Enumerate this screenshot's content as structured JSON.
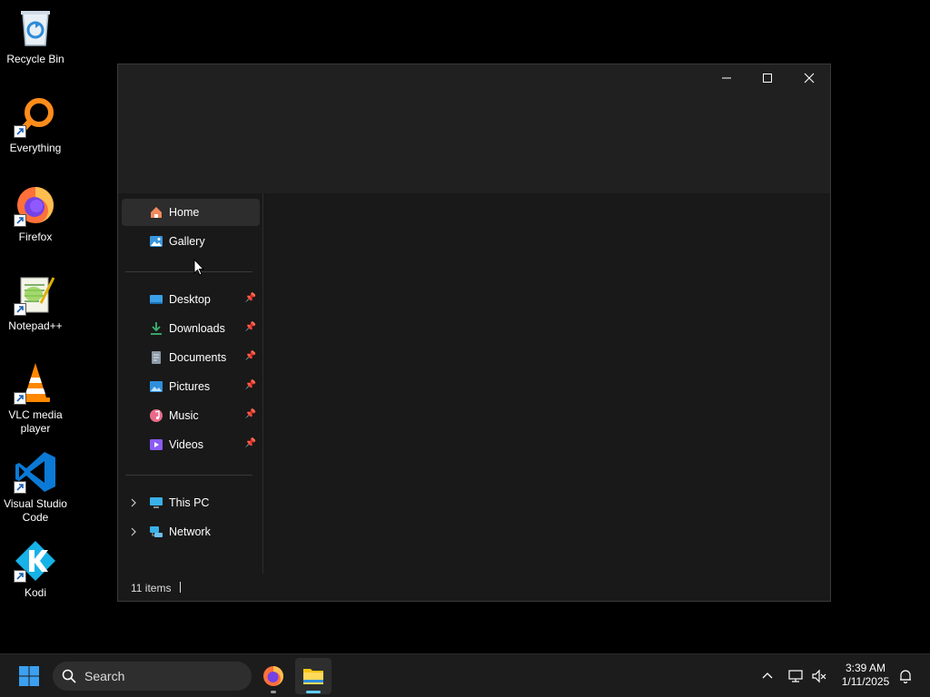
{
  "desktop": {
    "icons": [
      {
        "name": "recycle-bin",
        "label": "Recycle Bin"
      },
      {
        "name": "everything",
        "label": "Everything"
      },
      {
        "name": "firefox",
        "label": "Firefox"
      },
      {
        "name": "notepadpp",
        "label": "Notepad++"
      },
      {
        "name": "vlc",
        "label": "VLC media player"
      },
      {
        "name": "vscode",
        "label": "Visual Studio Code"
      },
      {
        "name": "kodi",
        "label": "Kodi"
      }
    ]
  },
  "explorer": {
    "nav": {
      "home": "Home",
      "gallery": "Gallery",
      "desktop": "Desktop",
      "downloads": "Downloads",
      "documents": "Documents",
      "pictures": "Pictures",
      "music": "Music",
      "videos": "Videos",
      "this_pc": "This PC",
      "network": "Network"
    },
    "status": {
      "item_count": "11 items"
    }
  },
  "taskbar": {
    "search_placeholder": "Search",
    "apps": [
      "start-icon",
      "firefox-icon",
      "file-explorer-icon"
    ],
    "clock": {
      "time": "3:39 AM",
      "date": "1/11/2025"
    }
  },
  "colors": {
    "accent": "#0078d4",
    "window_bg": "#191919",
    "titlebar_bg": "#202020",
    "taskbar_bg": "#1c1c1c"
  }
}
